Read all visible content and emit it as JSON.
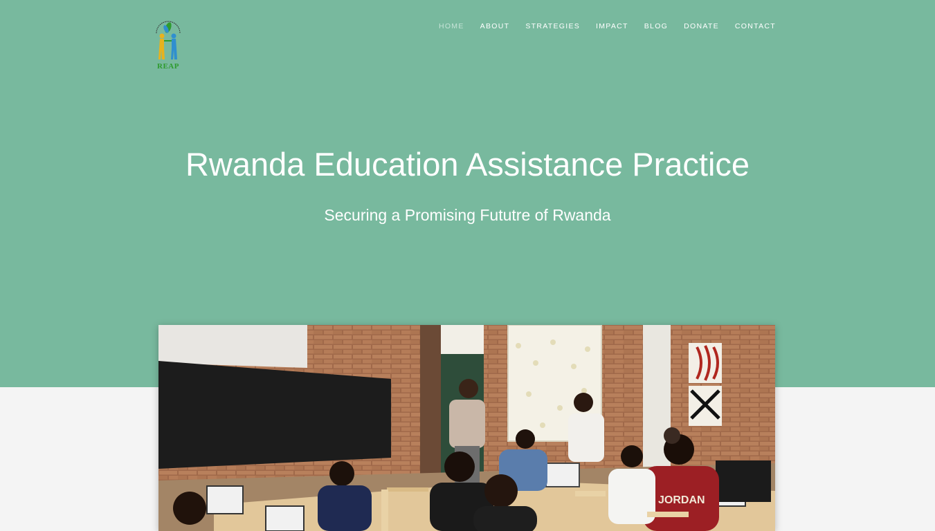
{
  "logo": {
    "text": "REAP",
    "ring_text": "RWANDA EDUCATION",
    "colors": {
      "text": "#2e9b2e",
      "figure_left": "#e8b21e",
      "figure_right": "#2f8fcf",
      "leaf": "#2e9b2e"
    }
  },
  "nav": {
    "items": [
      {
        "label": "HOME",
        "active": true
      },
      {
        "label": "ABOUT"
      },
      {
        "label": "STRATEGIES"
      },
      {
        "label": "IMPACT"
      },
      {
        "label": "BLOG"
      },
      {
        "label": "DONATE"
      },
      {
        "label": "CONTACT"
      }
    ]
  },
  "hero": {
    "title": "Rwanda Education Assistance Practice",
    "subtitle": "Securing a Promising Fututre of Rwanda",
    "background": "#78b99e"
  },
  "photo": {
    "subject": "classroom-computer-lab"
  }
}
